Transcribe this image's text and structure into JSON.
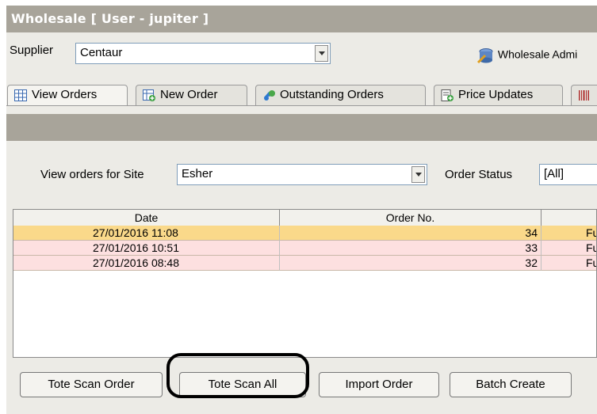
{
  "window": {
    "title": "Wholesale  [ User - jupiter ]"
  },
  "supplier": {
    "label": "Supplier",
    "value": "Centaur"
  },
  "admin_link": {
    "label": "Wholesale Admi"
  },
  "tabs": [
    {
      "label": "View Orders",
      "icon": "grid-icon",
      "active": true
    },
    {
      "label": "New Order",
      "icon": "new-order-icon",
      "active": false
    },
    {
      "label": "Outstanding Orders",
      "icon": "outstanding-orders-icon",
      "active": false
    },
    {
      "label": "Price Updates",
      "icon": "price-updates-icon",
      "active": false
    },
    {
      "label": "",
      "icon": "barcode-icon",
      "active": false
    }
  ],
  "filters": {
    "site_label": "View orders for Site",
    "site_value": "Esher",
    "status_label": "Order Status",
    "status_value": "[All]"
  },
  "table": {
    "columns": [
      "Date",
      "Order No.",
      ""
    ],
    "rows": [
      {
        "date": "27/01/2016 11:08",
        "order_no": "34",
        "status": "Ful",
        "selected": true
      },
      {
        "date": "27/01/2016 10:51",
        "order_no": "33",
        "status": "Ful",
        "selected": false
      },
      {
        "date": "27/01/2016 08:48",
        "order_no": "32",
        "status": "Ful",
        "selected": false
      }
    ]
  },
  "buttons": {
    "tote_scan_order": "Tote Scan Order",
    "tote_scan_all": "Tote Scan All",
    "import_order": "Import Order",
    "batch_create": "Batch Create"
  },
  "colors": {
    "title_bar": "#a8a49a",
    "selected_row": "#fad98a",
    "row_highlight": "#fde0e0",
    "panel_bg": "#ecebe6"
  }
}
